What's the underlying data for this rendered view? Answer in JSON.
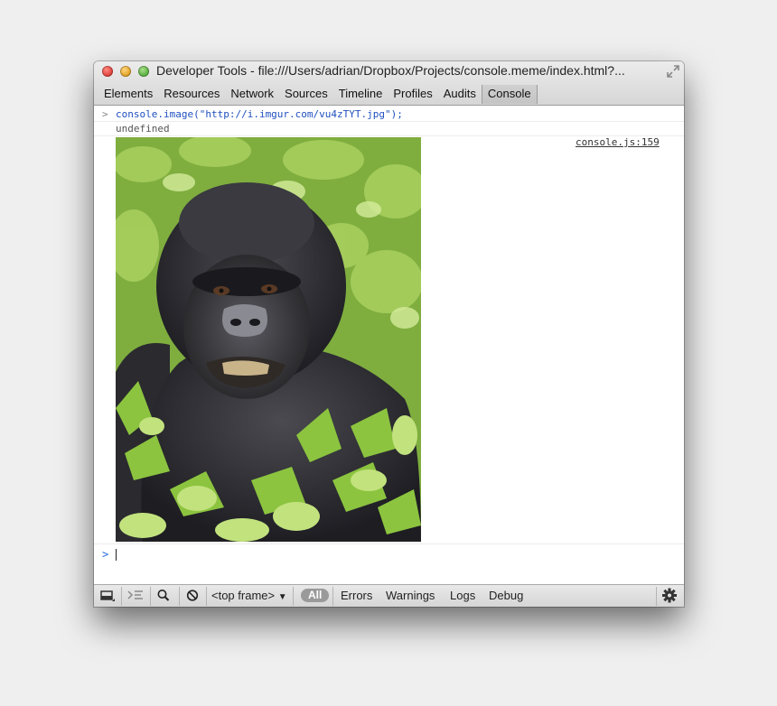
{
  "window": {
    "title": "Developer Tools - file:///Users/adrian/Dropbox/Projects/console.meme/index.html?..."
  },
  "tabs": [
    {
      "label": "Elements"
    },
    {
      "label": "Resources"
    },
    {
      "label": "Network"
    },
    {
      "label": "Sources"
    },
    {
      "label": "Timeline"
    },
    {
      "label": "Profiles"
    },
    {
      "label": "Audits"
    },
    {
      "label": "Console"
    }
  ],
  "active_tab": "Console",
  "console": {
    "command": "console.image(\"http://i.imgur.com/vu4zTYT.jpg\");",
    "result": "undefined",
    "source_link": "console.js:159",
    "prompt_symbol": ">",
    "input_symbol": ">"
  },
  "statusbar": {
    "frame_select": "<top frame>",
    "filter_all": "All",
    "filters": [
      "Errors",
      "Warnings",
      "Logs",
      "Debug"
    ]
  },
  "colors": {
    "command_text": "#1f4fbf",
    "input_prompt": "#2a6ce0",
    "filter_pill": "#9a9a9a"
  },
  "icons": [
    "dock-icon",
    "execution-context-icon",
    "search-icon",
    "clear-console-icon",
    "dropdown-arrow-icon",
    "settings-gear-icon",
    "fullscreen-icon"
  ]
}
